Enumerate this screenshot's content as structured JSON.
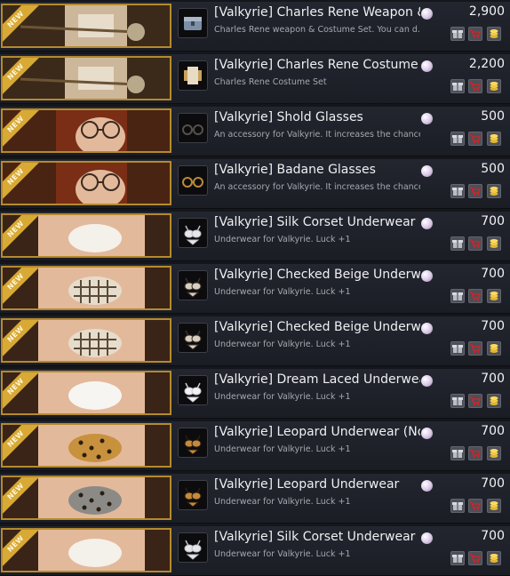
{
  "shop": {
    "new_label": "NEW",
    "items": [
      {
        "name": "[Valkyrie] Charles Rene Weapon & ..",
        "desc": "Charles Rene weapon & Costume Set. You can d...",
        "price": "2,900",
        "thumb": "weapon",
        "icon": "chest"
      },
      {
        "name": "[Valkyrie] Charles Rene Costume S..",
        "desc": "Charles Rene Costume Set",
        "price": "2,200",
        "thumb": "weapon",
        "icon": "costume"
      },
      {
        "name": "[Valkyrie] Shold Glasses",
        "desc": "An accessory for Valkyrie. It increases the chance...",
        "price": "500",
        "thumb": "glasses",
        "icon": "glasses-dark"
      },
      {
        "name": "[Valkyrie] Badane Glasses",
        "desc": "An accessory for Valkyrie. It increases the chance...",
        "price": "500",
        "thumb": "glasses",
        "icon": "glasses-gold"
      },
      {
        "name": "[Valkyrie] Silk Corset Underwear",
        "desc": "Underwear for Valkyrie. Luck +1",
        "price": "700",
        "thumb": "white",
        "icon": "corset-white"
      },
      {
        "name": "[Valkyrie] Checked Beige Underwea..",
        "desc": "Underwear for Valkyrie. Luck +1",
        "price": "700",
        "thumb": "checked",
        "icon": "corset-checked"
      },
      {
        "name": "[Valkyrie] Checked Beige Underwea..",
        "desc": "Underwear for Valkyrie. Luck +1",
        "price": "700",
        "thumb": "checked",
        "icon": "corset-checked"
      },
      {
        "name": "[Valkyrie] Dream Laced Underwear",
        "desc": "Underwear for Valkyrie. Luck +1",
        "price": "700",
        "thumb": "lace",
        "icon": "corset-lace"
      },
      {
        "name": "[Valkyrie] Leopard Underwear (No S..",
        "desc": "Underwear for Valkyrie. Luck +1",
        "price": "700",
        "thumb": "leopard",
        "icon": "corset-leopard"
      },
      {
        "name": "[Valkyrie] Leopard Underwear",
        "desc": "Underwear for Valkyrie. Luck +1",
        "price": "700",
        "thumb": "leopard-dark",
        "icon": "corset-leopard"
      },
      {
        "name": "[Valkyrie] Silk Corset Underwear",
        "desc": "Underwear for Valkyrie. Luck +1",
        "price": "700",
        "thumb": "white",
        "icon": "corset-white"
      }
    ]
  },
  "icons": {
    "currency": "pearl-icon",
    "gift": "gift-icon",
    "cart": "cart-icon",
    "buy": "coin-stack-icon"
  },
  "colors": {
    "thumb_border": "#b58a2e",
    "new_ribbon": "#d8a935",
    "cart_red": "#c8262b",
    "coin_gold": "#e0b530"
  }
}
